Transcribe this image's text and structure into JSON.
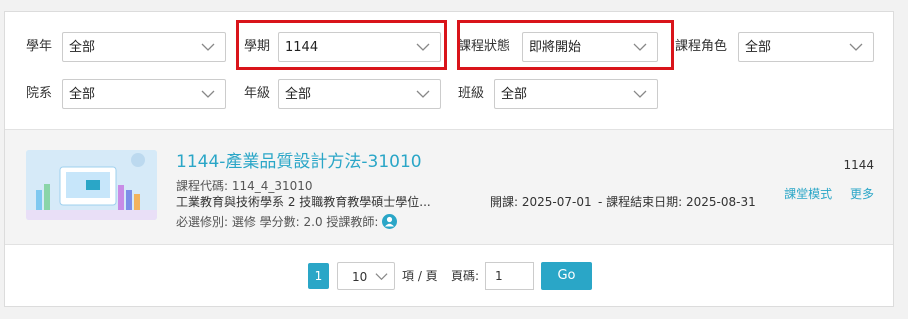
{
  "filters": {
    "year": {
      "label": "學年",
      "value": "全部"
    },
    "term": {
      "label": "學期",
      "value": "1144"
    },
    "status": {
      "label": "課程狀態",
      "value": "即將開始"
    },
    "role": {
      "label": "課程角色",
      "value": "全部"
    },
    "dept": {
      "label": "院系",
      "value": "全部"
    },
    "grade": {
      "label": "年級",
      "value": "全部"
    },
    "class": {
      "label": "班級",
      "value": "全部"
    }
  },
  "course": {
    "title": "1144-產業品質設計方法-31010",
    "code_line": "課程代碼: 114_4_31010",
    "dept_line": "工業教育與技術學系   2   技職教育教學碩士學位...",
    "start_line": "開課: 2025-07-01",
    "end_line": "-   課程結束日期: 2025-08-31",
    "meta_line": "必選修別: 選修     學分數: 2.0     授課教師:",
    "term_tag": "1144",
    "action_classroom": "課堂模式",
    "action_more": "更多"
  },
  "pagination": {
    "current_page": "1",
    "page_size": "10",
    "per_page_label": "項 / 頁",
    "page_label": "頁碼:",
    "page_input": "1",
    "go_label": "Go"
  },
  "colors": {
    "accent": "#2aa6c7",
    "highlight": "#d9141a"
  }
}
